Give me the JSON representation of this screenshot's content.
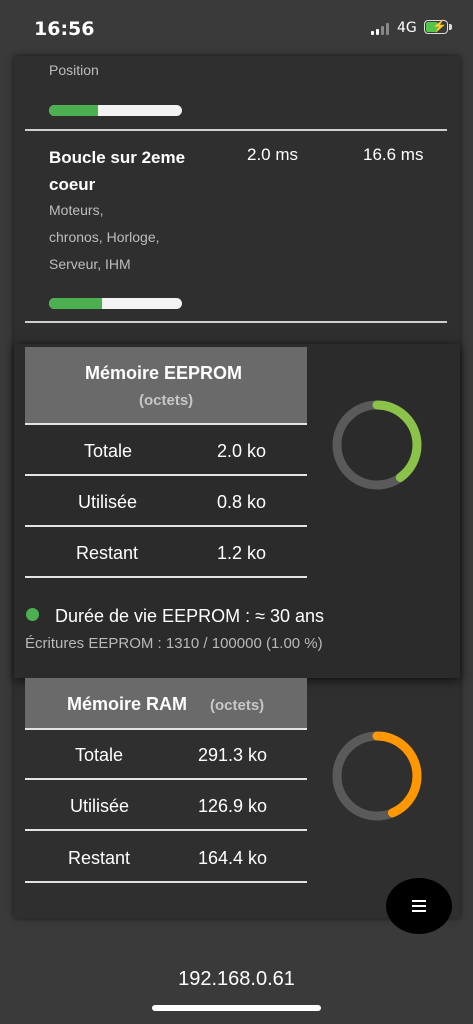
{
  "status_bar": {
    "time": "16:56",
    "network": "4G",
    "battery_level": 0.6
  },
  "tasks": [
    {
      "label": "Position",
      "progress": 0.37
    },
    {
      "name": "Boucle sur 2eme coeur",
      "current": "2.0 ms",
      "max": "16.6 ms",
      "description": [
        "Moteurs,",
        "chronos, Horloge,",
        "Serveur, IHM"
      ],
      "progress": 0.4
    }
  ],
  "eeprom": {
    "title": "Mémoire EEPROM",
    "unit": "(octets)",
    "rows": [
      {
        "label": "Totale",
        "value": "2.0 ko"
      },
      {
        "label": "Utilisée",
        "value": "0.8 ko"
      },
      {
        "label": "Restant",
        "value": "1.2 ko"
      }
    ],
    "donut_fraction": 0.4,
    "donut_color": "#8bc34a",
    "lifetime": "Durée de vie EEPROM : ≈ 30 ans",
    "lifetime_color": "#4caf50",
    "writes": "Écritures EEPROM : 1310 / 100000 (1.00 %)"
  },
  "ram": {
    "title": "Mémoire RAM",
    "unit": "(octets)",
    "rows": [
      {
        "label": "Totale",
        "value": "291.3 ko"
      },
      {
        "label": "Utilisée",
        "value": "126.9 ko"
      },
      {
        "label": "Restant",
        "value": "164.4 ko"
      }
    ],
    "donut_fraction": 0.436,
    "donut_color": "#ff9800"
  },
  "menu_icon": "menu-icon",
  "address_bar": {
    "url": "192.168.0.61"
  }
}
